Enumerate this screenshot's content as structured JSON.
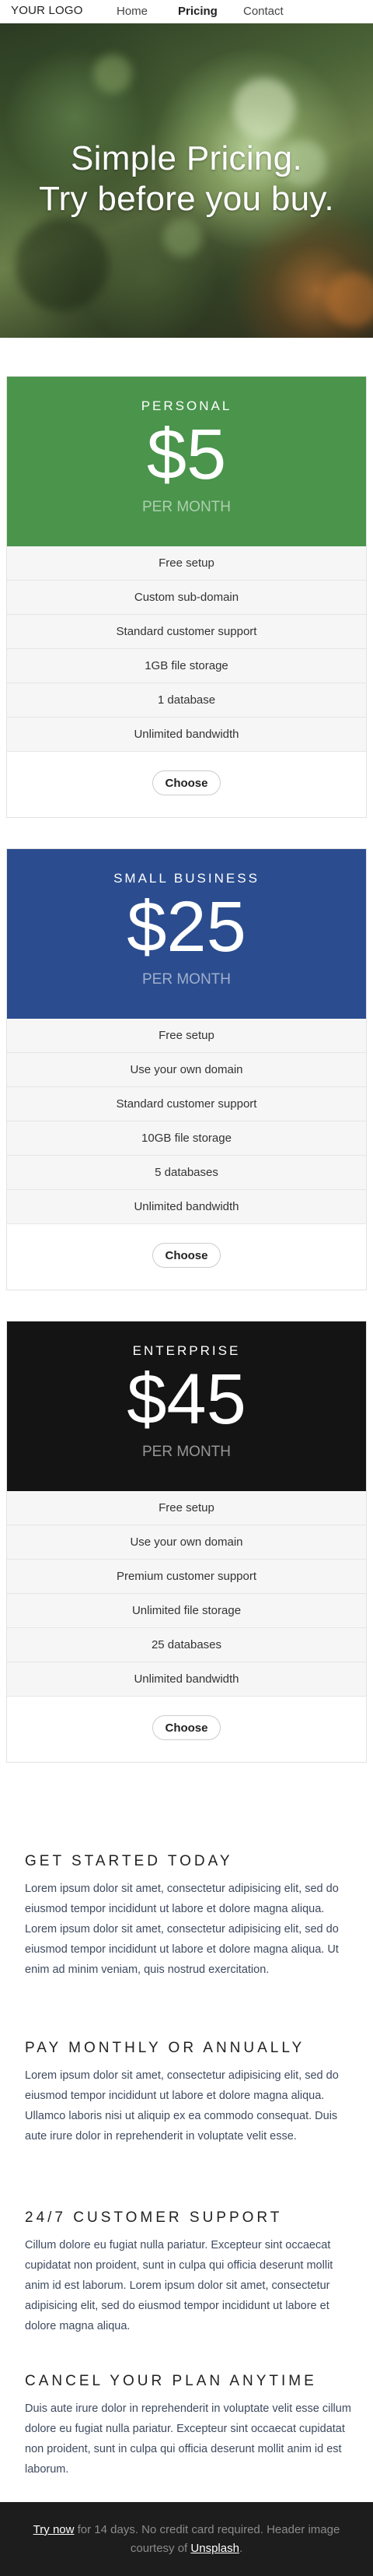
{
  "nav": {
    "logo": "YOUR LOGO",
    "links": [
      "Home",
      "Pricing",
      "Contact"
    ],
    "active": "Pricing"
  },
  "hero": {
    "line1": "Simple Pricing.",
    "line2": "Try before you buy."
  },
  "plans": [
    {
      "name": "PERSONAL",
      "price": "$5",
      "period": "PER MONTH",
      "color": "#4a944c",
      "features": [
        "Free setup",
        "Custom sub-domain",
        "Standard customer support",
        "1GB file storage",
        "1 database",
        "Unlimited bandwidth"
      ],
      "cta": "Choose"
    },
    {
      "name": "SMALL BUSINESS",
      "price": "$25",
      "period": "PER MONTH",
      "color": "#2b4d8f",
      "features": [
        "Free setup",
        "Use your own domain",
        "Standard customer support",
        "10GB file storage",
        "5 databases",
        "Unlimited bandwidth"
      ],
      "cta": "Choose"
    },
    {
      "name": "ENTERPRISE",
      "price": "$45",
      "period": "PER MONTH",
      "color": "#141414",
      "features": [
        "Free setup",
        "Use your own domain",
        "Premium customer support",
        "Unlimited file storage",
        "25 databases",
        "Unlimited bandwidth"
      ],
      "cta": "Choose"
    }
  ],
  "sections": [
    {
      "title": "GET STARTED TODAY",
      "body": "Lorem ipsum dolor sit amet, consectetur adipisicing elit, sed do eiusmod tempor incididunt ut labore et dolore magna aliqua. Lorem ipsum dolor sit amet, consectetur adipisicing elit, sed do eiusmod tempor incididunt ut labore et dolore magna aliqua. Ut enim ad minim veniam, quis nostrud exercitation."
    },
    {
      "title": "PAY MONTHLY OR ANNUALLY",
      "body": "Lorem ipsum dolor sit amet, consectetur adipisicing elit, sed do eiusmod tempor incididunt ut labore et dolore magna aliqua. Ullamco laboris nisi ut aliquip ex ea commodo consequat. Duis aute irure dolor in reprehenderit in voluptate velit esse."
    },
    {
      "title": "24/7 CUSTOMER SUPPORT",
      "body": "Cillum dolore eu fugiat nulla pariatur. Excepteur sint occaecat cupidatat non proident, sunt in culpa qui officia deserunt mollit anim id est laborum. Lorem ipsum dolor sit amet, consectetur adipisicing elit, sed do eiusmod tempor incididunt ut labore et dolore magna aliqua."
    },
    {
      "title": "CANCEL YOUR PLAN ANYTIME",
      "body": "Duis aute irure dolor in reprehenderit in voluptate velit esse cillum dolore eu fugiat nulla pariatur. Excepteur sint occaecat cupidatat non proident, sunt in culpa qui officia deserunt mollit anim id est laborum."
    }
  ],
  "footer": {
    "try_link": "Try now",
    "text_1": " for 14 days. No credit card required. Header image courtesy of ",
    "credit_link": "Unsplash",
    "text_2": "."
  }
}
